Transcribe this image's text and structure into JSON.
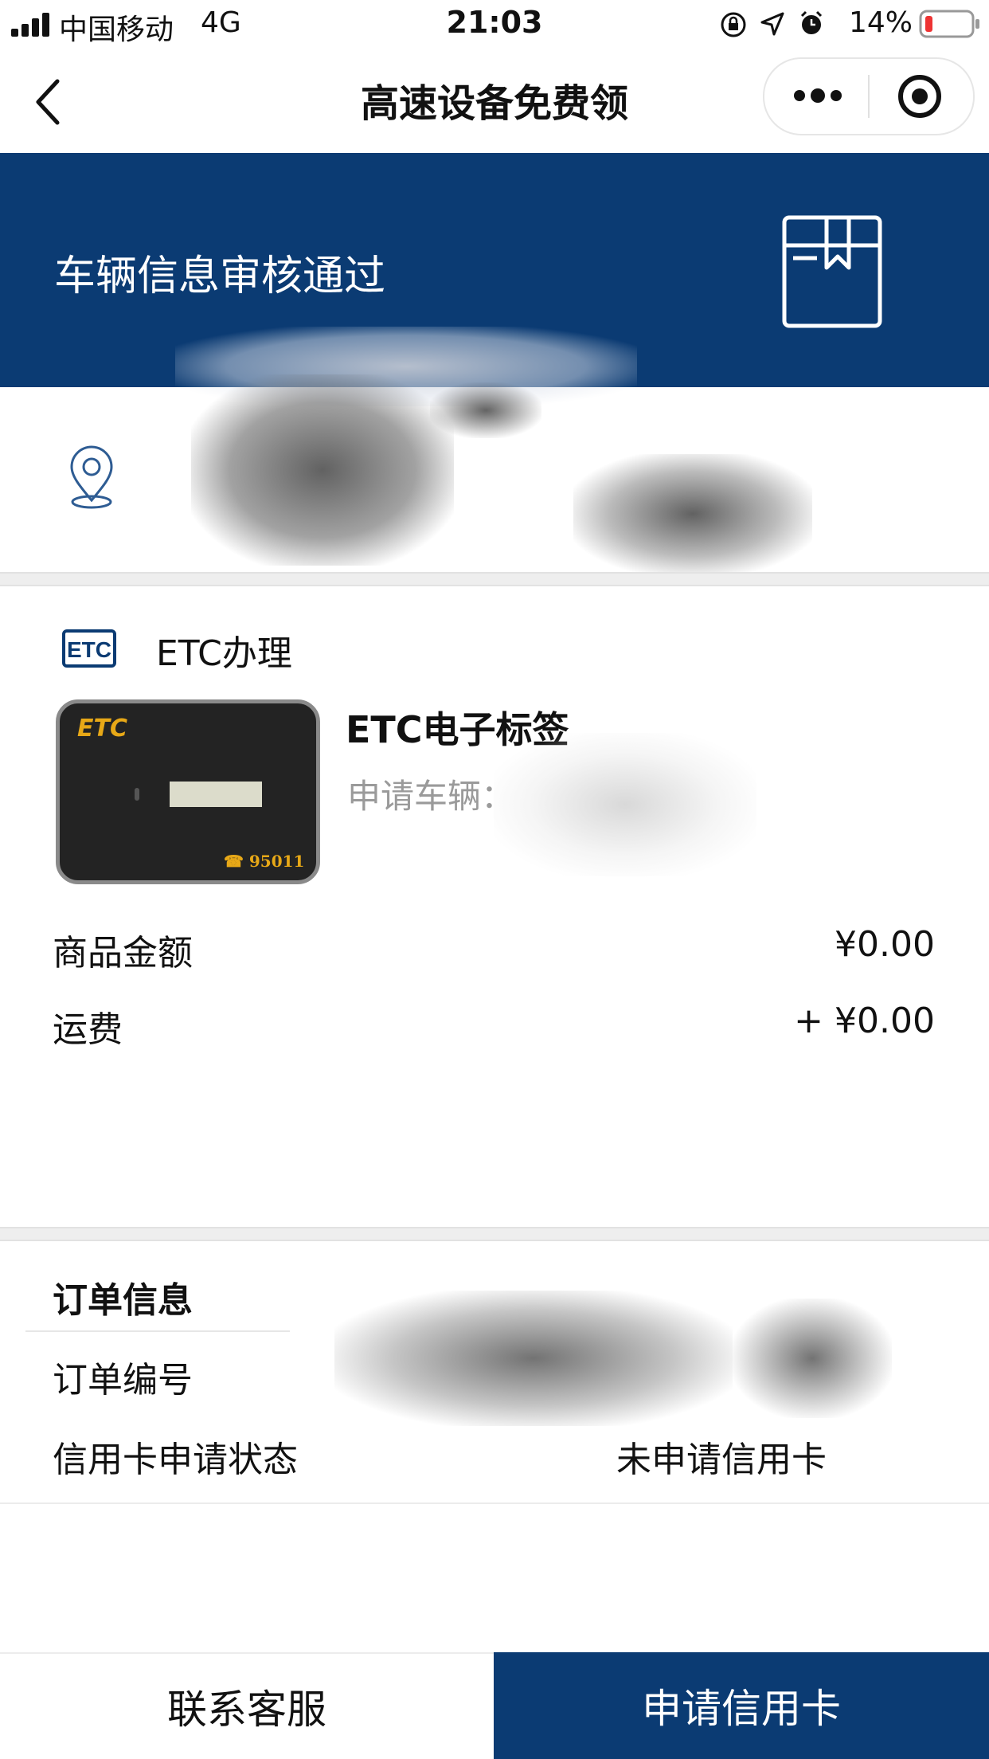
{
  "status_bar": {
    "carrier": "中国移动",
    "network": "4G",
    "time": "21:03",
    "battery": "14%"
  },
  "nav": {
    "title": "高速设备免费领",
    "back_icon": "chevron-left-icon",
    "more_icon": "more-dots-icon",
    "close_icon": "target-icon"
  },
  "banner": {
    "text": "车辆信息审核通过",
    "icon": "package-icon",
    "background": "#0b3b73"
  },
  "address": {
    "icon": "location-pin-icon"
  },
  "etc": {
    "section_label": "ETC办理",
    "logo_text": "ETC",
    "device_brand": "ETC",
    "device_phone": "☎ 95011",
    "product_title": "ETC电子标签",
    "vehicle_label": "申请车辆："
  },
  "pricing": {
    "amount_label": "商品金额",
    "amount_value": "¥0.00",
    "shipping_label": "运费",
    "shipping_value": "+ ¥0.00"
  },
  "order": {
    "title": "订单信息",
    "number_label": "订单编号",
    "credit_label": "信用卡申请状态",
    "credit_value": "未申请信用卡"
  },
  "bottom": {
    "contact_label": "联系客服",
    "apply_label": "申请信用卡",
    "accent": "#0b3b73"
  }
}
